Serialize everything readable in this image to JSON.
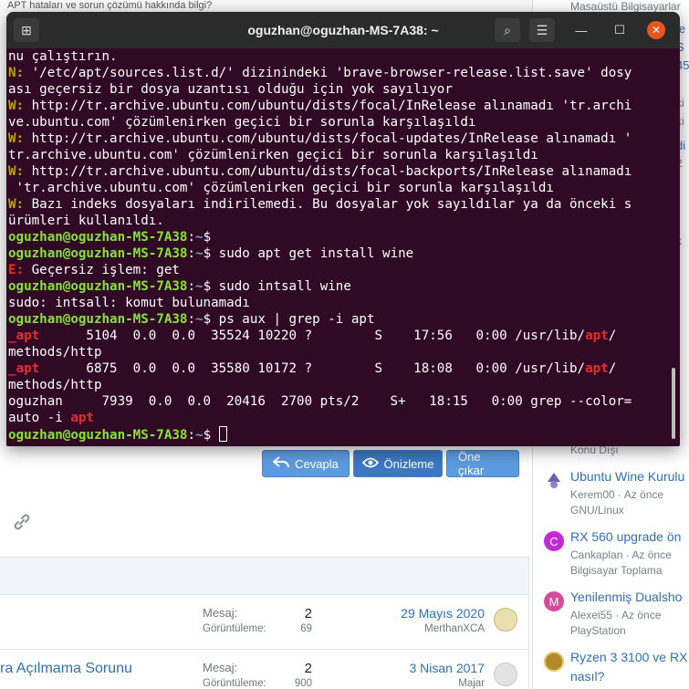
{
  "browser": {
    "top_fragment": "APT hataları ve sorun çözümü hakkında bilgi?",
    "sidebar_top_fragment": "Masaüstü Bilgisayarlar",
    "right_edge_fragments": [
      "le",
      "S",
      "45",
      "ki",
      "ki",
      "di",
      "2",
      "k"
    ]
  },
  "terminal": {
    "title": "oguzhan@oguzhan-MS-7A38: ~",
    "new_tab_glyph": "⊞",
    "search_glyph": "⌕",
    "menu_glyph": "☰",
    "minimize_glyph": "—",
    "maximize_glyph": "☐",
    "close_glyph": "✕",
    "prompt_user": "oguzhan@oguzhan-MS-7A38",
    "prompt_sep": ":",
    "prompt_dir": "~",
    "prompt_sym": "$ ",
    "lines": [
      {
        "kind": "plain",
        "text": "nu çalıştırın."
      },
      {
        "kind": "note",
        "tag": "N: ",
        "text": "'/etc/apt/sources.list.d/' dizinindeki 'brave-browser-release.list.save' dosy"
      },
      {
        "kind": "plain",
        "text": "ası geçersiz bir dosya uzantısı olduğu için yok sayılıyor"
      },
      {
        "kind": "warn",
        "tag": "W: ",
        "text": "http://tr.archive.ubuntu.com/ubuntu/dists/focal/InRelease alınamadı 'tr.archi"
      },
      {
        "kind": "plain",
        "text": "ve.ubuntu.com' çözümlenirken geçici bir sorunla karşılaşıldı"
      },
      {
        "kind": "warn",
        "tag": "W: ",
        "text": "http://tr.archive.ubuntu.com/ubuntu/dists/focal-updates/InRelease alınamadı '"
      },
      {
        "kind": "plain",
        "text": "tr.archive.ubuntu.com' çözümlenirken geçici bir sorunla karşılaşıldı"
      },
      {
        "kind": "warn",
        "tag": "W: ",
        "text": "http://tr.archive.ubuntu.com/ubuntu/dists/focal-backports/InRelease alınamadı"
      },
      {
        "kind": "plain",
        "text": " 'tr.archive.ubuntu.com' çözümlenirken geçici bir sorunla karşılaşıldı"
      },
      {
        "kind": "warn",
        "tag": "W: ",
        "text": "Bazı indeks dosyaları indirilemedi. Bu dosyalar yok sayıldılar ya da önceki s"
      },
      {
        "kind": "plain",
        "text": "ürümleri kullanıldı."
      },
      {
        "kind": "prompt",
        "cmd": ""
      },
      {
        "kind": "prompt",
        "cmd": "sudo apt get install wine"
      },
      {
        "kind": "error",
        "tag": "E: ",
        "text": "Geçersiz işlem: get"
      },
      {
        "kind": "prompt",
        "cmd": "sudo intsall wine"
      },
      {
        "kind": "plain",
        "text": "sudo: intsall: komut bulunamadı"
      },
      {
        "kind": "prompt",
        "cmd": "ps aux | grep -i apt"
      },
      {
        "kind": "proc",
        "hl": "_apt",
        "text": "      5104  0.0  0.0  35524 10220 ?        S    17:56   0:00 /usr/lib/",
        "hl2": "apt",
        "tail": "/"
      },
      {
        "kind": "plain",
        "text": "methods/http"
      },
      {
        "kind": "proc",
        "hl": "_apt",
        "text": "      6875  0.0  0.0  35580 10172 ?        S    18:08   0:00 /usr/lib/",
        "hl2": "apt",
        "tail": "/"
      },
      {
        "kind": "plain",
        "text": "methods/http"
      },
      {
        "kind": "plain",
        "text": "oguzhan     7939  0.0  0.0  20416  2700 pts/2    S+   18:15   0:00 grep --color="
      },
      {
        "kind": "grep",
        "text": "auto -i ",
        "hl": "apt"
      },
      {
        "kind": "cursorline"
      }
    ]
  },
  "forum": {
    "buttons": {
      "reply": "Cevapla",
      "preview": "Önizleme",
      "feature": "Öne çıkar"
    },
    "threads": [
      {
        "title": "",
        "replies_label": "Mesaj:",
        "replies": "2",
        "views_label": "Görüntüleme:",
        "views": "69",
        "date": "29 Mayıs 2020",
        "user": "MerthanXCA"
      },
      {
        "title": "ra Açılmama Sorunu",
        "replies_label": "Mesaj:",
        "replies": "2",
        "views_label": "Görüntüleme:",
        "views": "900",
        "date": "3 Nisan 2017",
        "user": "Majar"
      }
    ],
    "sidebar_fragment": "Konu Dışı",
    "sidebar": [
      {
        "title": "Ubuntu Wine Kurulu",
        "meta1": "Kerem00 · Az önce",
        "meta2": "GNU/Linux",
        "avatar_letter": "",
        "avatar_color": "#6a5fb5"
      },
      {
        "title": "RX 560 upgrade ön",
        "meta1": "Cankaplan · Az önce",
        "meta2": "Bilgisayar Toplama",
        "avatar_letter": "C",
        "avatar_color": "#c22ad8"
      },
      {
        "title": "Yenilenmiş Dualsho",
        "meta1": "Alexei55 · Az önce",
        "meta2": "PlayStation",
        "avatar_letter": "M",
        "avatar_color": "#d84a9a"
      },
      {
        "title": "Ryzen 3 3100 ve RX",
        "meta1": "nasıl?",
        "meta2": "",
        "avatar_letter": "",
        "avatar_color": "#b38a2a"
      }
    ]
  }
}
